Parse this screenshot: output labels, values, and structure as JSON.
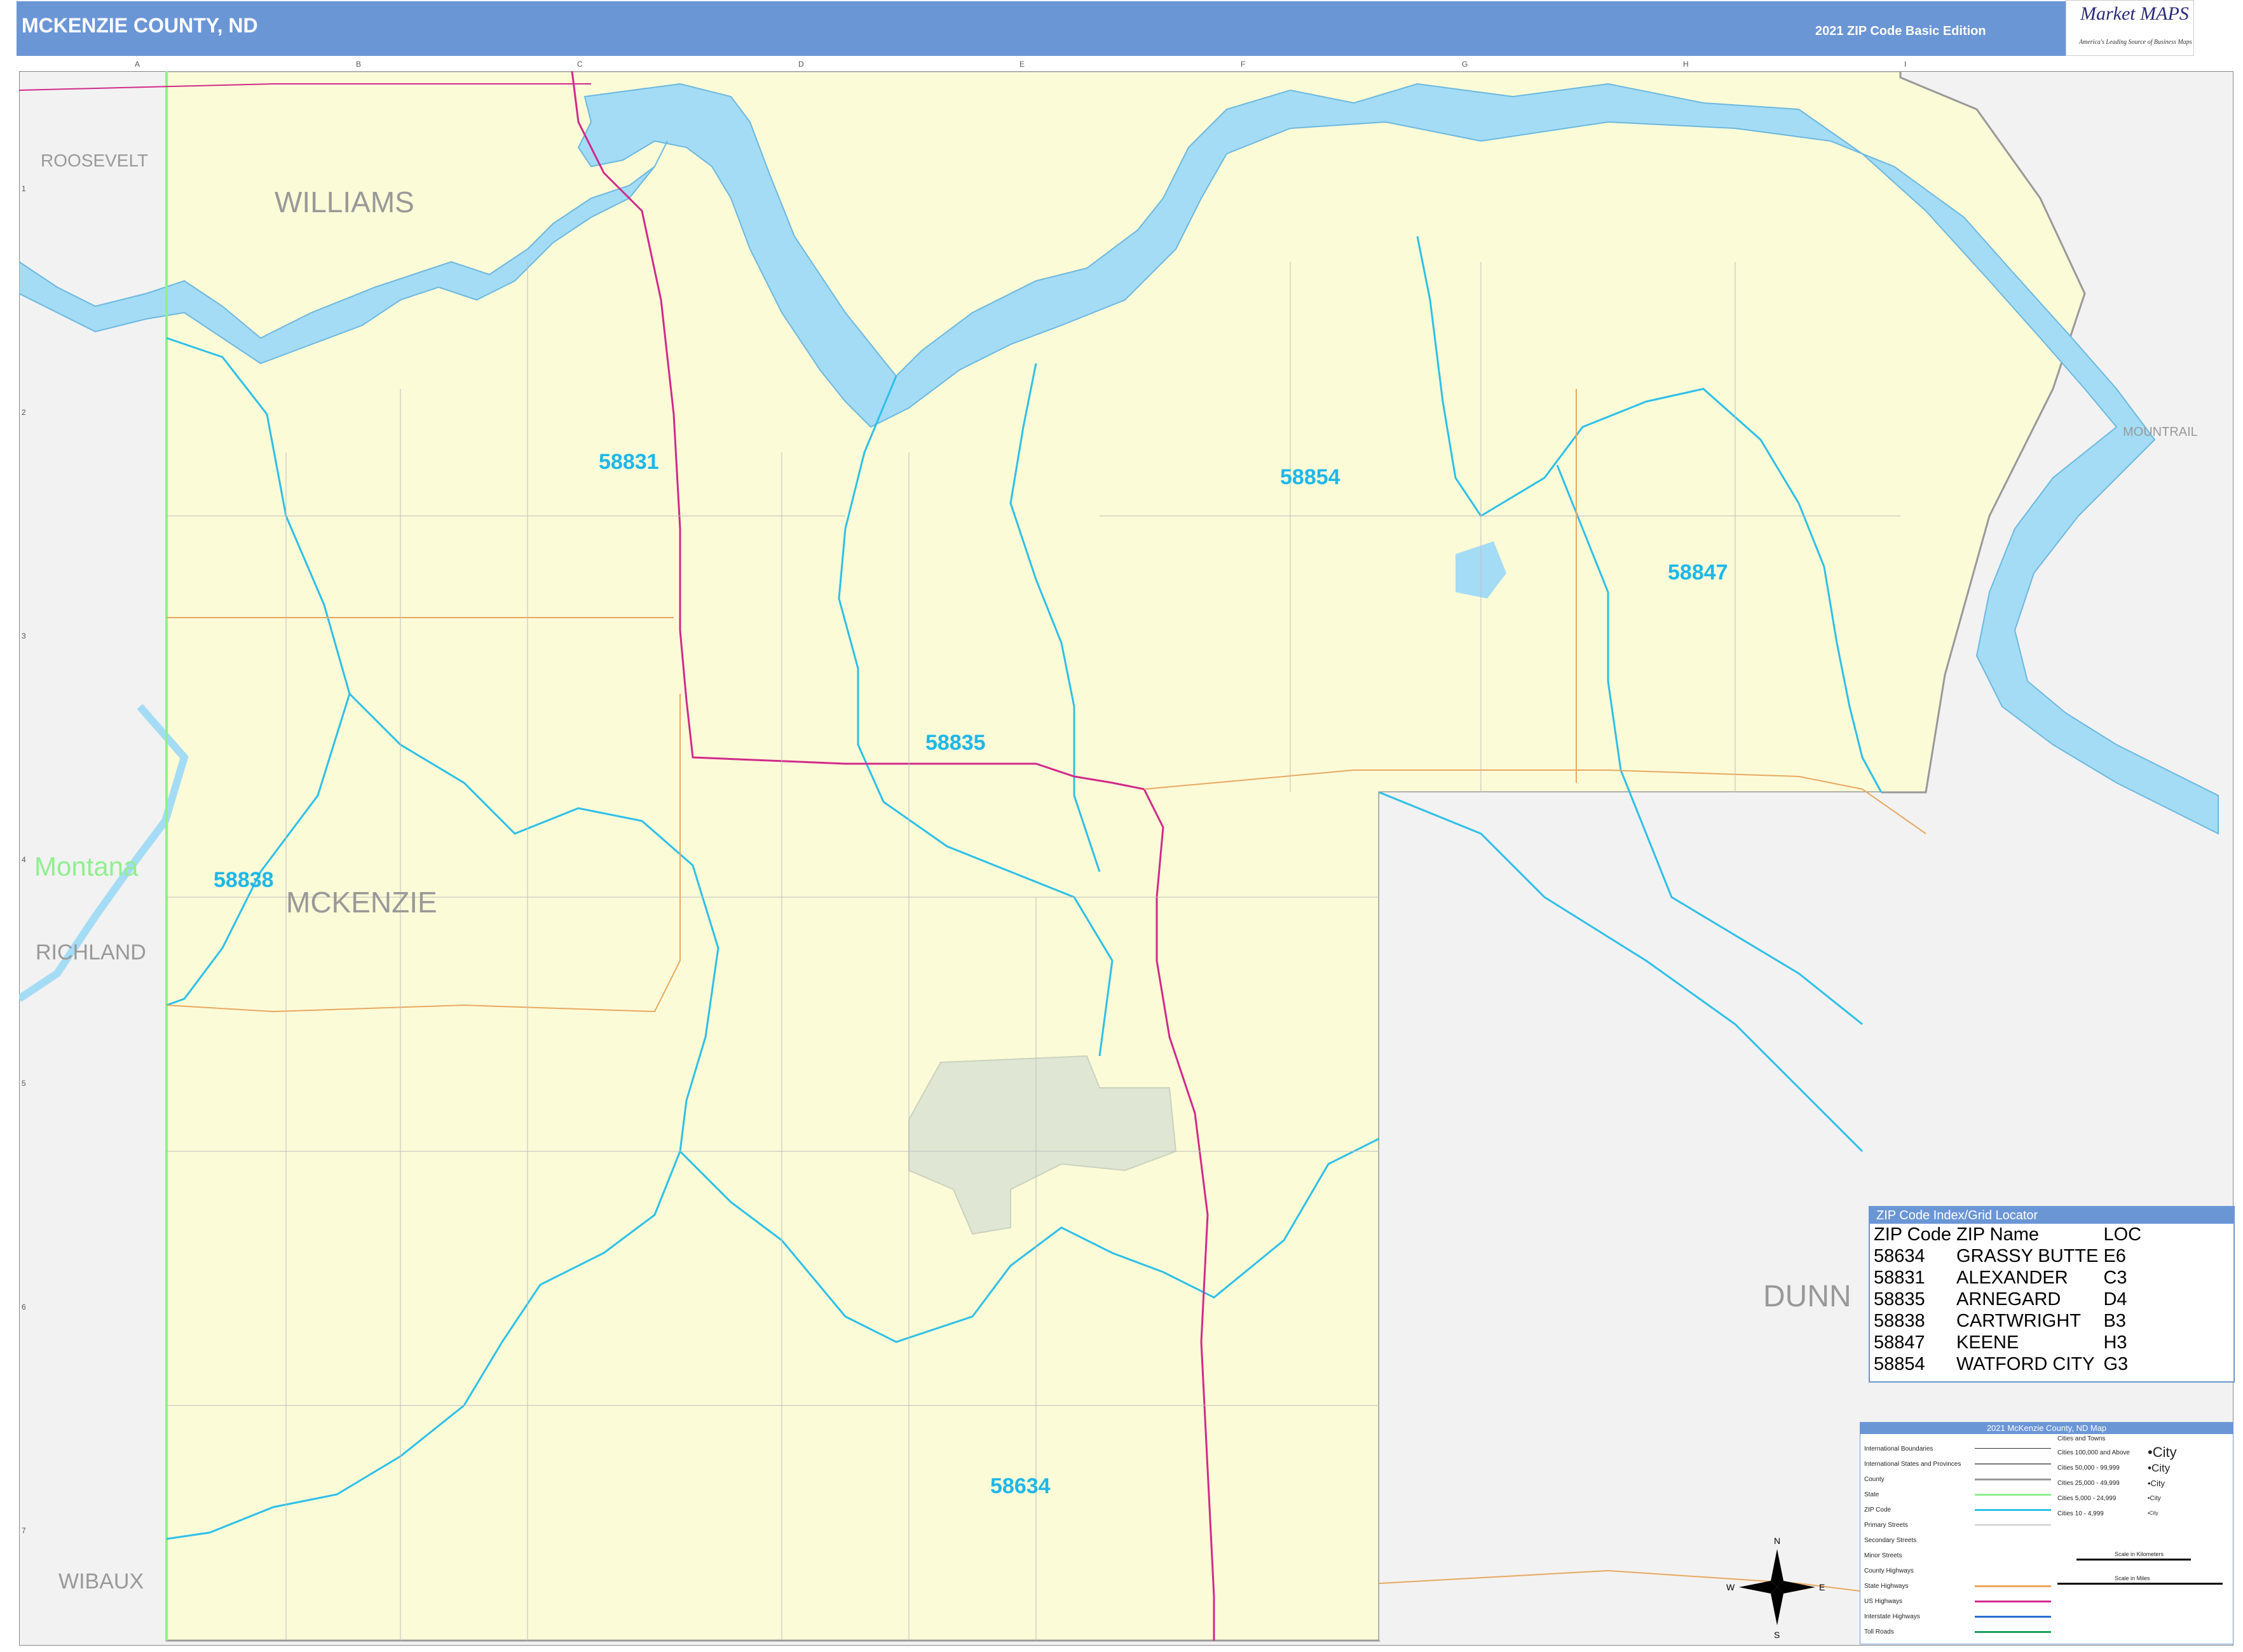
{
  "header": {
    "title": "MCKENZIE COUNTY, ND",
    "edition": "2021 ZIP Code Basic Edition",
    "logo_brand": "Market MAPS",
    "logo_tagline": "America's Leading Source of Business Maps"
  },
  "grid": {
    "columns": [
      "A",
      "B",
      "C",
      "D",
      "E",
      "F",
      "G",
      "H",
      "I"
    ],
    "rows": [
      "1",
      "2",
      "3",
      "4",
      "5",
      "6",
      "7"
    ]
  },
  "counties": {
    "roosevelt": "ROOSEVELT",
    "williams": "WILLIAMS",
    "mountrail": "MOUNTRAIL",
    "mckenzie": "MCKENZIE",
    "richland": "RICHLAND",
    "dunn": "DUNN",
    "wibaux": "WIBAUX",
    "state_montana": "Montana"
  },
  "zip_labels": [
    "58831",
    "58854",
    "58847",
    "58835",
    "58838",
    "58634"
  ],
  "zip_index": {
    "title": "ZIP Code Index/Grid Locator",
    "headers": [
      "ZIP Code",
      "ZIP Name",
      "LOC"
    ],
    "rows": [
      [
        "58634",
        "GRASSY BUTTE",
        "E6"
      ],
      [
        "58831",
        "ALEXANDER",
        "C3"
      ],
      [
        "58835",
        "ARNEGARD",
        "D4"
      ],
      [
        "58838",
        "CARTWRIGHT",
        "B3"
      ],
      [
        "58847",
        "KEENE",
        "H3"
      ],
      [
        "58854",
        "WATFORD CITY",
        "G3"
      ]
    ]
  },
  "legend": {
    "title": "2021 McKenzie County, ND Map",
    "left_items": [
      "International Boundaries",
      "International States and Provinces",
      "County",
      "State",
      "ZIP Code",
      "Primary Streets",
      "Secondary Streets",
      "Minor Streets",
      "County Highways",
      "State Highways",
      "US Highways",
      "Interstate Highways",
      "Toll Roads"
    ],
    "cities_title": "Cities and Towns",
    "city_items": [
      "Cities 100,000 and Above",
      "Cities 50,000 - 99,999",
      "Cities 25,000 - 49,999",
      "Cities 5,000 - 24,999",
      "Cities 10 - 4,999"
    ],
    "city_samples": [
      "•City",
      "•City",
      "•City",
      "•City",
      "•City"
    ],
    "scale_km": "Scale in Kilometers",
    "scale_mi": "Scale in Miles"
  },
  "compass": {
    "n": "N",
    "s": "S",
    "e": "E",
    "w": "W"
  },
  "colors": {
    "header": "#6b96d6",
    "county_fill": "#fcfbd8",
    "outside_fill": "#f2f2f2",
    "water": "#a4dcf5",
    "zip_boundary": "#2ec0e8",
    "state_line": "#8fef8f",
    "us_highway": "#d12a8a",
    "state_highway": "#e8a860",
    "park": "#dfe6d4"
  }
}
